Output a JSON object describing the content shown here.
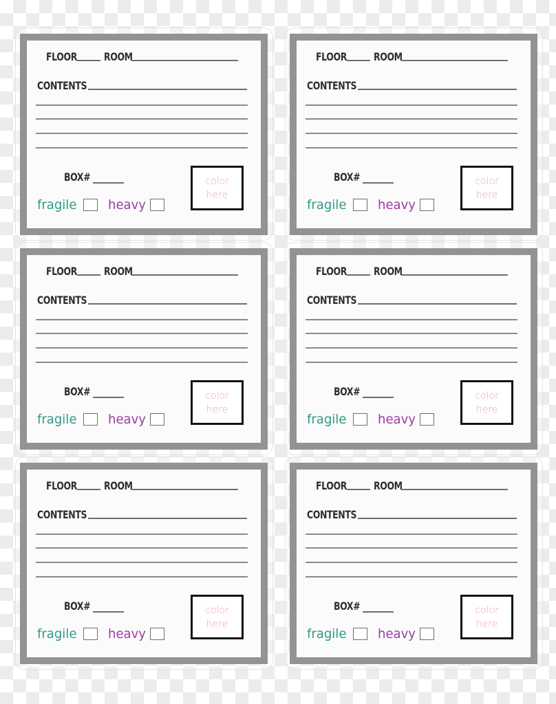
{
  "colors": {
    "frame": "#939393",
    "text": "#2e2e2e",
    "fragile": "#2f9a86",
    "heavy": "#9b3ea3",
    "color_here": "#f49ac9"
  },
  "labels": [
    {
      "floor": "FLOOR",
      "room": "ROOM",
      "contents": "CONTENTS",
      "box": "BOX#",
      "fragile": "fragile",
      "heavy": "heavy",
      "color_line1": "color",
      "color_line2": "here"
    },
    {
      "floor": "FLOOR",
      "room": "ROOM",
      "contents": "CONTENTS",
      "box": "BOX#",
      "fragile": "fragile",
      "heavy": "heavy",
      "color_line1": "color",
      "color_line2": "here"
    },
    {
      "floor": "FLOOR",
      "room": "ROOM",
      "contents": "CONTENTS",
      "box": "BOX#",
      "fragile": "fragile",
      "heavy": "heavy",
      "color_line1": "color",
      "color_line2": "here"
    },
    {
      "floor": "FLOOR",
      "room": "ROOM",
      "contents": "CONTENTS",
      "box": "BOX#",
      "fragile": "fragile",
      "heavy": "heavy",
      "color_line1": "color",
      "color_line2": "here"
    },
    {
      "floor": "FLOOR",
      "room": "ROOM",
      "contents": "CONTENTS",
      "box": "BOX#",
      "fragile": "fragile",
      "heavy": "heavy",
      "color_line1": "color",
      "color_line2": "here"
    },
    {
      "floor": "FLOOR",
      "room": "ROOM",
      "contents": "CONTENTS",
      "box": "BOX#",
      "fragile": "fragile",
      "heavy": "heavy",
      "color_line1": "color",
      "color_line2": "here"
    }
  ]
}
